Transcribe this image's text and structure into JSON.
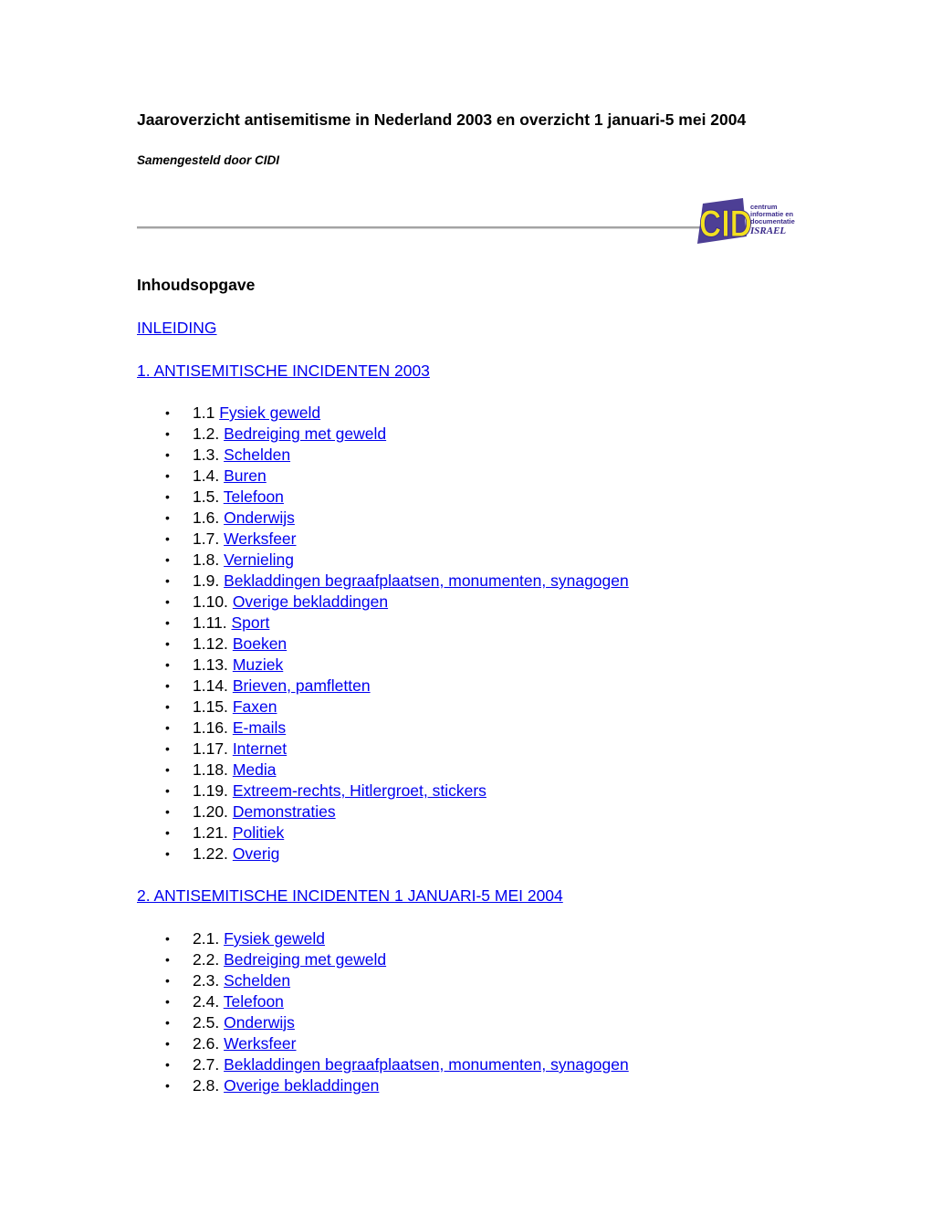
{
  "document": {
    "title": "Jaaroverzicht antisemitisme in Nederland 2003 en overzicht 1 januari-5 mei 2004",
    "subtitle": "Samengesteld door CIDI",
    "logo": {
      "letters": "CIDI",
      "tagline_lines": [
        "centrum",
        "informatie en",
        "documentatie"
      ],
      "country": "ISRAEL",
      "colors": {
        "letters": "#f2e020",
        "outline": "#3a2a8a",
        "text": "#3a2a8a"
      }
    },
    "toc_heading": "Inhoudsopgave",
    "link_color": "#0000ee",
    "bullet_glyph": "•"
  },
  "toc": {
    "intro": {
      "label": "INLEIDING"
    },
    "sections": [
      {
        "label": "1. ANTISEMITISCHE INCIDENTEN 2003",
        "items": [
          {
            "number": "1.1",
            "label": "Fysiek geweld"
          },
          {
            "number": "1.2.",
            "label": "Bedreiging met geweld"
          },
          {
            "number": "1.3.",
            "label": "Schelden"
          },
          {
            "number": "1.4.",
            "label": "Buren"
          },
          {
            "number": "1.5.",
            "label": "Telefoon"
          },
          {
            "number": "1.6.",
            "label": "Onderwijs"
          },
          {
            "number": "1.7.",
            "label": "Werksfeer"
          },
          {
            "number": "1.8.",
            "label": "Vernieling"
          },
          {
            "number": "1.9.",
            "label": "Bekladdingen begraafplaatsen, monumenten, synagogen"
          },
          {
            "number": "1.10.",
            "label": "Overige bekladdingen"
          },
          {
            "number": "1.11.",
            "label": "Sport"
          },
          {
            "number": "1.12.",
            "label": "Boeken"
          },
          {
            "number": "1.13.",
            "label": "Muziek"
          },
          {
            "number": "1.14.",
            "label": "Brieven, pamfletten"
          },
          {
            "number": "1.15.",
            "label": "Faxen"
          },
          {
            "number": "1.16.",
            "label": "E-mails"
          },
          {
            "number": "1.17.",
            "label": "Internet"
          },
          {
            "number": "1.18.",
            "label": "Media"
          },
          {
            "number": "1.19.",
            "label": "Extreem-rechts, Hitlergroet, stickers"
          },
          {
            "number": "1.20.",
            "label": "Demonstraties"
          },
          {
            "number": "1.21.",
            "label": "Politiek"
          },
          {
            "number": "1.22.",
            "label": "Overig"
          }
        ]
      },
      {
        "label": "2. ANTISEMITISCHE INCIDENTEN 1 JANUARI-5 MEI 2004",
        "items": [
          {
            "number": "2.1.",
            "label": "Fysiek geweld"
          },
          {
            "number": "2.2.",
            "label": "Bedreiging met geweld"
          },
          {
            "number": "2.3.",
            "label": "Schelden"
          },
          {
            "number": "2.4.",
            "label": "Telefoon"
          },
          {
            "number": "2.5.",
            "label": "Onderwijs"
          },
          {
            "number": "2.6.",
            "label": "Werksfeer"
          },
          {
            "number": "2.7.",
            "label": "Bekladdingen begraafplaatsen, monumenten, synagogen"
          },
          {
            "number": "2.8.",
            "label": "Overige bekladdingen"
          }
        ]
      }
    ]
  }
}
